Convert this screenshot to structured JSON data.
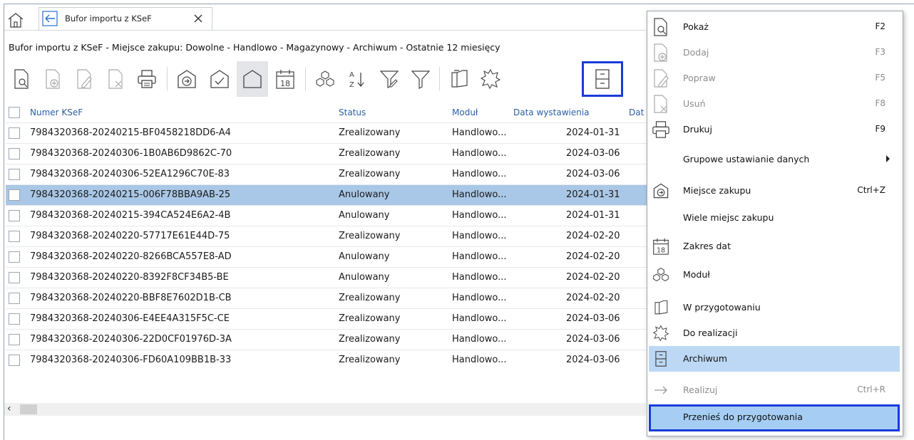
{
  "tab": {
    "title": "Bufor importu z KSeF"
  },
  "subtitle": "Bufor importu z KSeF - Miejsce zakupu: Dowolne - Handlowo - Magazynowy - Archiwum - Ostatnie 12 miesięcy",
  "toolbar": {
    "date_icon_label": "18"
  },
  "table": {
    "headers": [
      "Numer KSeF",
      "Status",
      "Moduł",
      "Data wystawienia",
      "Dat"
    ],
    "rows": [
      [
        "7984320368-20240215-BF0458218DD6-A4",
        "Zrealizowany",
        "Handlowo...",
        "2024-01-31"
      ],
      [
        "7984320368-20240306-1B0AB6D9862C-70",
        "Zrealizowany",
        "Handlowo...",
        "2024-03-06"
      ],
      [
        "7984320368-20240306-52EA1296C70E-83",
        "Zrealizowany",
        "Handlowo...",
        "2024-03-06"
      ],
      [
        "7984320368-20240215-006F78BBA9AB-25",
        "Anulowany",
        "Handlowo...",
        "2024-01-31"
      ],
      [
        "7984320368-20240215-394CA524E6A2-4B",
        "Anulowany",
        "Handlowo...",
        "2024-01-31"
      ],
      [
        "7984320368-20240220-57717E61E44D-75",
        "Zrealizowany",
        "Handlowo...",
        "2024-02-20"
      ],
      [
        "7984320368-20240220-8266BCA557E8-AD",
        "Anulowany",
        "Handlowo...",
        "2024-02-20"
      ],
      [
        "7984320368-20240220-8392F8CF34B5-BE",
        "Anulowany",
        "Handlowo...",
        "2024-02-20"
      ],
      [
        "7984320368-20240220-BBF8E7602D1B-CB",
        "Zrealizowany",
        "Handlowo...",
        "2024-02-20"
      ],
      [
        "7984320368-20240306-E4EE4A315F5C-CE",
        "Zrealizowany",
        "Handlowo...",
        "2024-03-06"
      ],
      [
        "7984320368-20240306-22D0CF01976D-3A",
        "Zrealizowany",
        "Handlowo...",
        "2024-03-06"
      ],
      [
        "7984320368-20240306-FD60A109BB1B-33",
        "Zrealizowany",
        "Handlowo...",
        "2024-03-06"
      ]
    ],
    "selected_row": 3
  },
  "menu": {
    "items": [
      {
        "label": "Pokaż",
        "shortcut": "F2"
      },
      {
        "label": "Dodaj",
        "shortcut": "F3"
      },
      {
        "label": "Popraw",
        "shortcut": "F5"
      },
      {
        "label": "Usuń",
        "shortcut": "F8"
      },
      {
        "label": "Drukuj",
        "shortcut": "F9"
      },
      {
        "label": "Grupowe ustawianie danych",
        "shortcut": ""
      },
      {
        "label": "Miejsce zakupu",
        "shortcut": "Ctrl+Z"
      },
      {
        "label": "Wiele miejsc zakupu",
        "shortcut": ""
      },
      {
        "label": "Zakres dat",
        "shortcut": ""
      },
      {
        "label": "Moduł",
        "shortcut": ""
      },
      {
        "label": "W przygotowaniu",
        "shortcut": ""
      },
      {
        "label": "Do realizacji",
        "shortcut": ""
      },
      {
        "label": "Archiwum",
        "shortcut": ""
      },
      {
        "label": "Realizuj",
        "shortcut": "Ctrl+R"
      },
      {
        "label": "Przenieś do przygotowania",
        "shortcut": ""
      }
    ],
    "date_icon_label": "18"
  },
  "colors": {
    "selection": "#a9c7e6",
    "menu_highlight": "#bcd8f4",
    "focus_outline": "#1a3bd9",
    "header_text": "#2a5fa8"
  }
}
